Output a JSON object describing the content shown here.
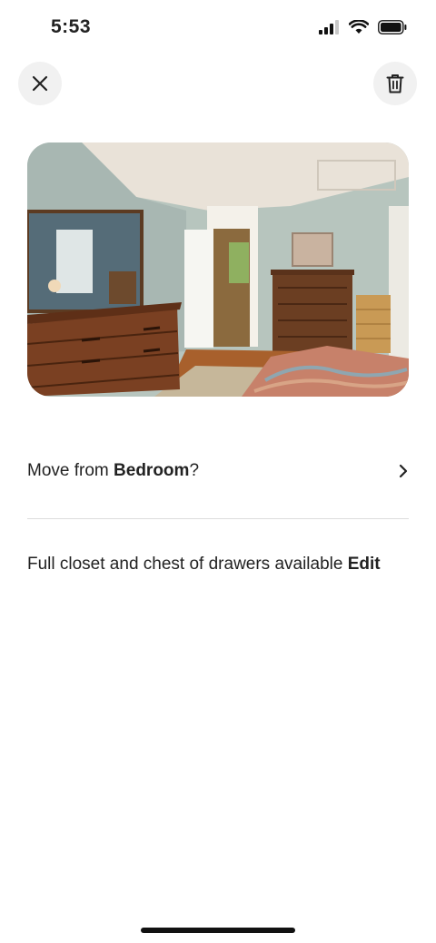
{
  "status": {
    "time": "5:53"
  },
  "header": {
    "close_icon": "close-icon",
    "delete_icon": "trash-icon"
  },
  "photo": {
    "subject": "bedroom-photo"
  },
  "move": {
    "prefix": "Move from ",
    "room": "Bedroom",
    "suffix": "?"
  },
  "description": {
    "text": "Full closet and chest of drawers available ",
    "edit_label": "Edit"
  }
}
